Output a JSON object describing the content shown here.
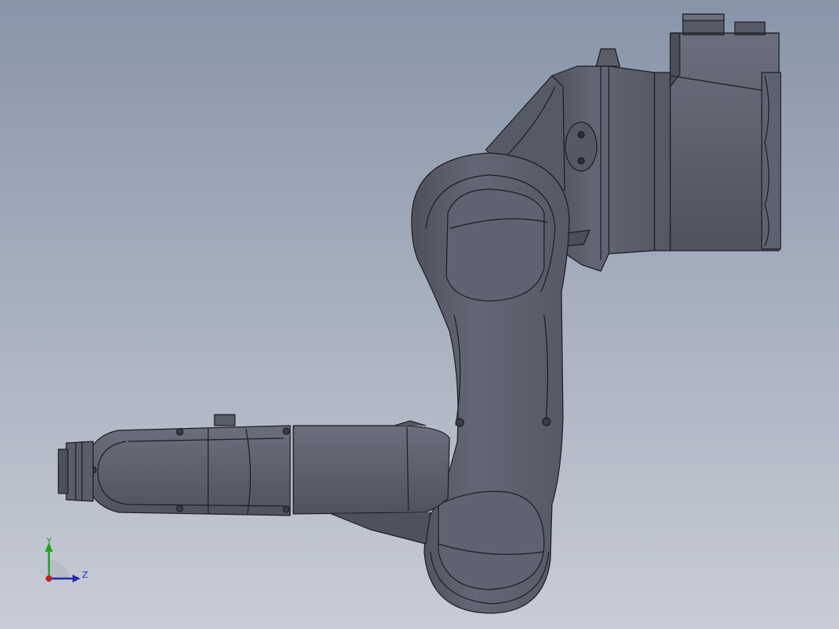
{
  "viewport": {
    "background_top": "#8895a8",
    "background_bottom": "#c8ccd6"
  },
  "model": {
    "part": "robot-arm",
    "body_color": "#5b5e6b",
    "body_light": "#6a6e7c",
    "body_dark": "#4a4d58",
    "edge_color": "#1c1d24"
  },
  "triad": {
    "y_label": "Y",
    "z_label": "Z",
    "y_color": "#1fa51f",
    "z_color": "#2a2ab5",
    "x_color": "#c02020"
  }
}
